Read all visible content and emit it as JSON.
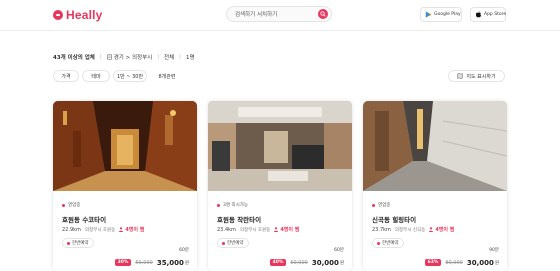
{
  "header": {
    "logo_text": "Heally",
    "search_placeholder": "검색하기 서치하기",
    "google_play_label": "Google Play",
    "app_store_label": "App Store"
  },
  "breadcrumb": {
    "count_text": "43개 이상의 업체",
    "location": "경기 > 의정부시",
    "filter_all": "전체",
    "person": "1명"
  },
  "filters": {
    "price": "가격",
    "theme": "테마",
    "time": "1만 ~ 30만",
    "sort": "8개관련",
    "map_label": "지도 표시하기"
  },
  "cards": [
    {
      "status": "영업중",
      "name": "호원동 수코타이",
      "distance": "22.9km",
      "address": "의정부시 호원동",
      "views": "4명이 찜",
      "tag": "한번예약",
      "duration": "60분",
      "discount": "30%",
      "original_price": "50,000",
      "final_price": "35,000",
      "currency": "원"
    },
    {
      "status": "3명 즉시가능",
      "name": "호원동 작란타이",
      "distance": "23.4km",
      "address": "의정부시 호원동",
      "views": "4명이 찜",
      "tag": "한번예약",
      "duration": "60분",
      "discount": "40%",
      "original_price": "50,000",
      "final_price": "30,000",
      "currency": "원"
    },
    {
      "status": "영업중",
      "name": "신곡동 힐링타이",
      "distance": "23.7km",
      "address": "의정부시 신곡동",
      "views": "4명이 찜",
      "tag": "한번예약",
      "duration": "90분",
      "discount": "63%",
      "original_price": "80,000",
      "final_price": "30,000",
      "currency": "원"
    }
  ],
  "colors": {
    "brand": "#e8365d",
    "text": "#222222",
    "muted": "#999999"
  }
}
